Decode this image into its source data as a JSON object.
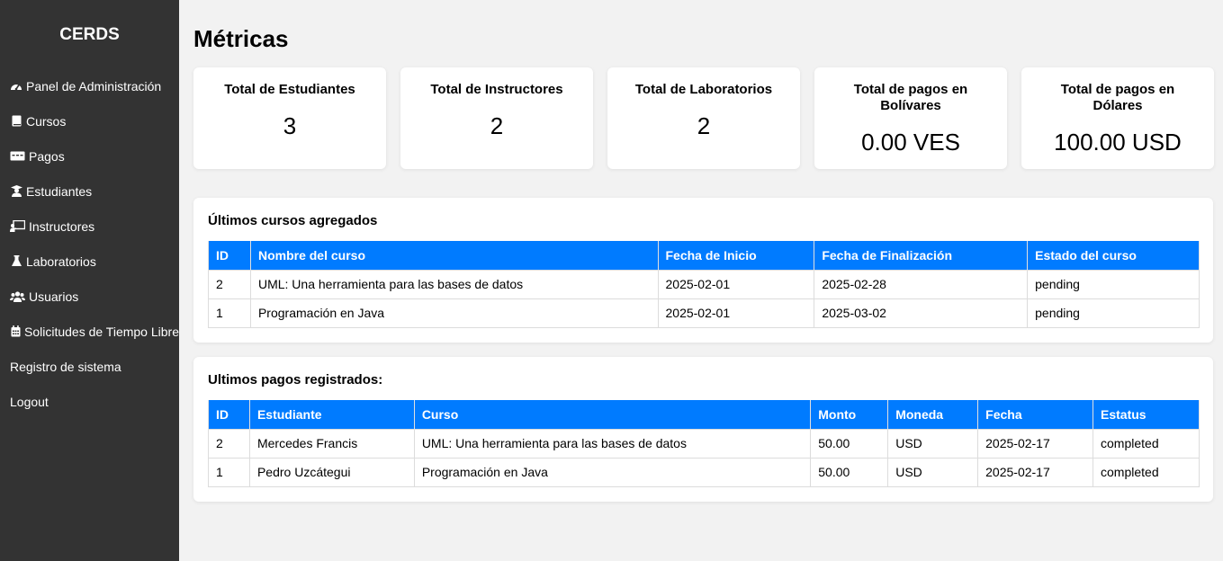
{
  "sidebar": {
    "brand": "CERDS",
    "items": [
      {
        "label": "Panel de Administración",
        "icon": "dashboard-icon"
      },
      {
        "label": "Cursos",
        "icon": "book-icon"
      },
      {
        "label": "Pagos",
        "icon": "money-bill-icon"
      },
      {
        "label": "Estudiantes",
        "icon": "graduate-icon"
      },
      {
        "label": "Instructores",
        "icon": "chalkboard-teacher-icon"
      },
      {
        "label": "Laboratorios",
        "icon": "flask-icon"
      },
      {
        "label": "Usuarios",
        "icon": "users-icon"
      },
      {
        "label": "Solicitudes de Tiempo Libre",
        "icon": "calendar-icon"
      },
      {
        "label": "Registro de sistema",
        "icon": ""
      },
      {
        "label": "Logout",
        "icon": ""
      }
    ]
  },
  "main": {
    "title": "Métricas",
    "metrics": [
      {
        "label": "Total de Estudiantes",
        "value": "3"
      },
      {
        "label": "Total de Instructores",
        "value": "2"
      },
      {
        "label": "Total de Laboratorios",
        "value": "2"
      },
      {
        "label": "Total de pagos en Bolívares",
        "value": "0.00 VES"
      },
      {
        "label": "Total de pagos en Dólares",
        "value": "100.00 USD"
      }
    ],
    "courses": {
      "title": "Últimos cursos agregados",
      "headers": [
        "ID",
        "Nombre del curso",
        "Fecha de Inicio",
        "Fecha de Finalización",
        "Estado del curso"
      ],
      "rows": [
        [
          "2",
          "UML: Una herramienta para las bases de datos",
          "2025-02-01",
          "2025-02-28",
          "pending"
        ],
        [
          "1",
          "Programación en Java",
          "2025-02-01",
          "2025-03-02",
          "pending"
        ]
      ]
    },
    "payments": {
      "title": "Ultimos pagos registrados:",
      "headers": [
        "ID",
        "Estudiante",
        "Curso",
        "Monto",
        "Moneda",
        "Fecha",
        "Estatus"
      ],
      "rows": [
        [
          "2",
          "Mercedes Francis",
          "UML: Una herramienta para las bases de datos",
          "50.00",
          "USD",
          "2025-02-17",
          "completed"
        ],
        [
          "1",
          "Pedro Uzcátegui",
          "Programación en Java",
          "50.00",
          "USD",
          "2025-02-17",
          "completed"
        ]
      ]
    }
  },
  "colors": {
    "sidebar_bg": "#333333",
    "table_header": "#007bff",
    "page_bg": "#f2f2f2"
  }
}
